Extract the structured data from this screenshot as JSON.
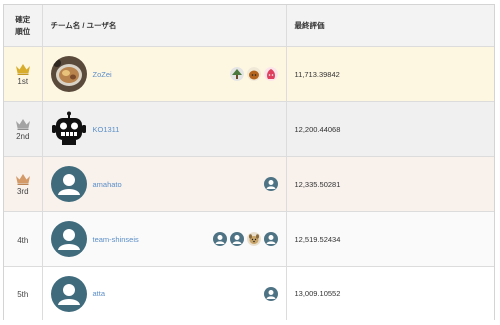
{
  "header": {
    "rank_label_line1": "確定",
    "rank_label_line2": "順位",
    "team_label": "チーム名 / ユーザ名",
    "score_label": "最終評価"
  },
  "rows": [
    {
      "rank": "1st",
      "team": "ZoZei",
      "score": "11,713.39842",
      "crown": "gold",
      "avatar": "food-photo-avatar",
      "members": [
        "tree-avatar-icon",
        "hedgehog-avatar-icon",
        "pink-blob-avatar-icon"
      ]
    },
    {
      "rank": "2nd",
      "team": "KO1311",
      "score": "12,200.44068",
      "crown": "silver",
      "avatar": "robot-avatar",
      "members": []
    },
    {
      "rank": "3rd",
      "team": "amahato",
      "score": "12,335.50281",
      "crown": "bronze",
      "avatar": "default-user-avatar",
      "members": [
        "default-user-icon"
      ]
    },
    {
      "rank": "4th",
      "team": "team-shinseis",
      "score": "12,519.52434",
      "crown": "",
      "avatar": "default-user-avatar",
      "members": [
        "default-user-icon",
        "default-user-icon",
        "dog-avatar-icon",
        "default-user-icon"
      ]
    },
    {
      "rank": "5th",
      "team": "atta",
      "score": "13,009.10552",
      "crown": "",
      "avatar": "default-user-avatar",
      "members": [
        "default-user-icon"
      ]
    }
  ],
  "colors": {
    "gold": "#d9ad2c",
    "silver": "#a3a3a3",
    "bronze": "#d49a67",
    "link": "#5b8ec7",
    "avatar_default": "#3f6b7c"
  }
}
